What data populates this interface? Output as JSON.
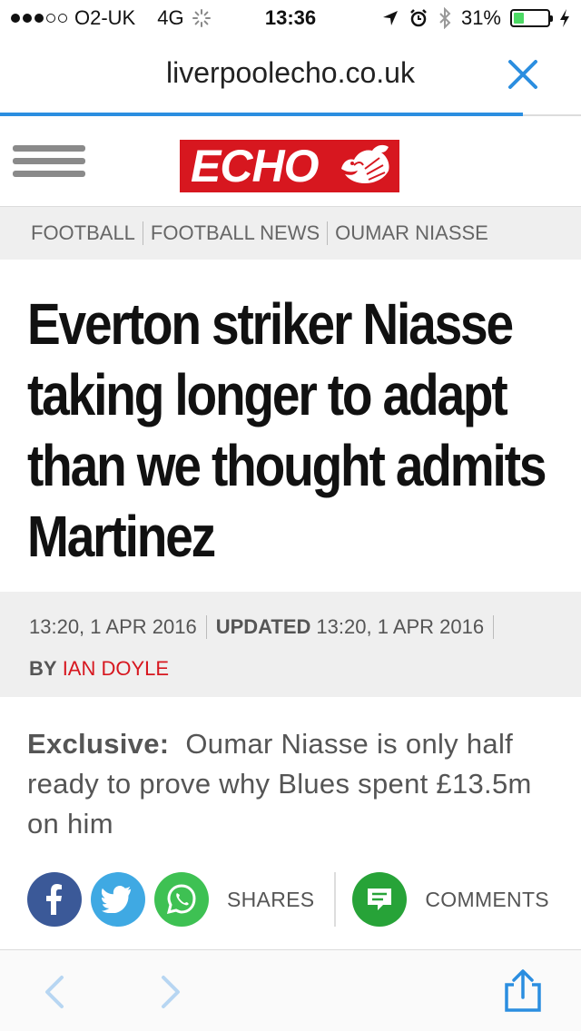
{
  "status_bar": {
    "carrier": "O2-UK",
    "network": "4G",
    "time": "13:36",
    "battery": "31%",
    "battery_level": 0.31
  },
  "address_bar": {
    "url": "liverpoolecho.co.uk",
    "load_progress": 0.9
  },
  "site": {
    "logo_text": "ECHO"
  },
  "breadcrumb": [
    "FOOTBALL",
    "FOOTBALL NEWS",
    "OUMAR NIASSE"
  ],
  "article": {
    "headline": "Everton striker Niasse taking longer to adapt than we thought admits Martinez",
    "published": "13:20, 1 APR 2016",
    "updated_label": "UPDATED",
    "updated": "13:20, 1 APR 2016",
    "by_label": "BY",
    "author": "IAN DOYLE",
    "standfirst_label": "Exclusive:",
    "standfirst": "Oumar Niasse is only half ready to prove why Blues spent £13.5m on him"
  },
  "share": {
    "shares_label": "SHARES",
    "comments_label": "COMMENTS"
  },
  "colors": {
    "accent": "#2b8ee0",
    "brand_red": "#d7171f",
    "facebook": "#3b5998",
    "twitter": "#3fa9e3",
    "whatsapp": "#3ec153"
  }
}
